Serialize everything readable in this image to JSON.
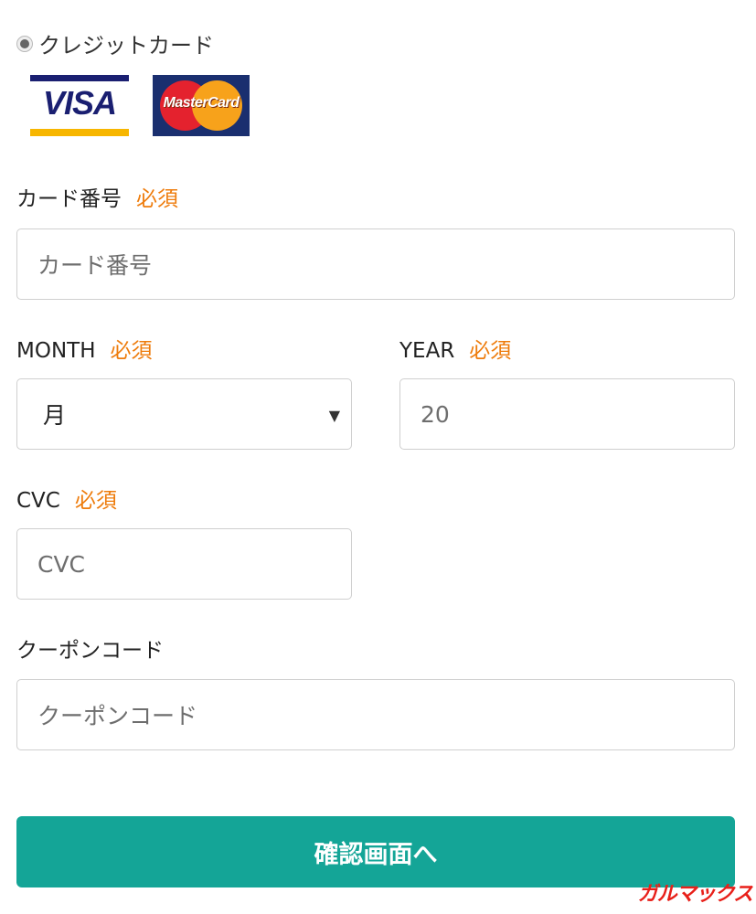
{
  "payment": {
    "method_label": "クレジットカード",
    "brands": {
      "visa": "VISA",
      "mastercard": "MasterCard"
    }
  },
  "required_text": "必須",
  "card_number": {
    "label": "カード番号",
    "placeholder": "カード番号"
  },
  "month": {
    "label": "MONTH",
    "selected": "月"
  },
  "year": {
    "label": "YEAR",
    "placeholder": "20"
  },
  "cvc": {
    "label": "CVC",
    "placeholder": "CVC"
  },
  "coupon": {
    "label": "クーポンコード",
    "placeholder": "クーポンコード"
  },
  "submit_label": "確認画面へ",
  "watermark": "ガルマックス",
  "colors": {
    "accent": "#14a597",
    "required": "#ee7c0c"
  }
}
